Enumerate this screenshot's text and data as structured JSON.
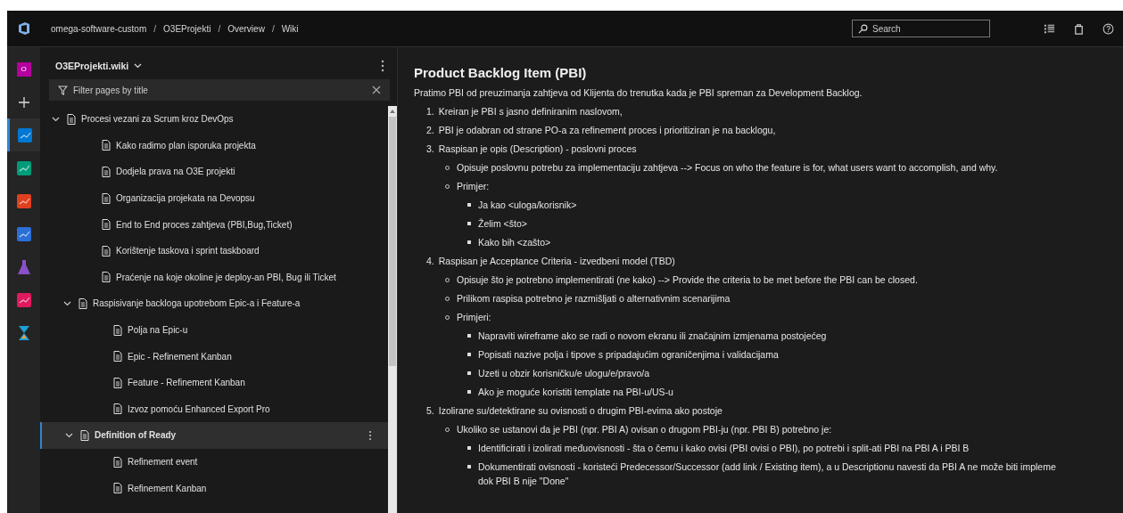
{
  "topbar": {
    "breadcrumb": [
      "omega-software-custom",
      "O3EProjekti",
      "Overview",
      "Wiki"
    ],
    "breadcrumb_separator": "/",
    "search": {
      "placeholder": "Search"
    }
  },
  "rail": [
    {
      "kind": "org",
      "label": "O",
      "selected": false
    },
    {
      "kind": "plus",
      "selected": false
    },
    {
      "kind": "overview",
      "selected": true
    },
    {
      "kind": "boards",
      "selected": false
    },
    {
      "kind": "repos",
      "selected": false
    },
    {
      "kind": "pipelines",
      "selected": false
    },
    {
      "kind": "testplans",
      "selected": false
    },
    {
      "kind": "artifacts",
      "selected": false
    },
    {
      "kind": "hourglass",
      "selected": false
    }
  ],
  "sidebar": {
    "wiki_name": "O3EProjekti.wiki",
    "filter": {
      "placeholder": "Filter pages by title"
    },
    "tree": [
      {
        "label": "Procesi vezani za Scrum kroz DevOps",
        "expanded": true,
        "selected": false,
        "children": [
          {
            "label": "Kako radimo plan isporuka projekta",
            "selected": false
          },
          {
            "label": "Dodjela prava na O3E projekti",
            "selected": false
          },
          {
            "label": "Organizacija projekata na Devopsu",
            "selected": false
          },
          {
            "label": "End to End proces zahtjeva (PBI,Bug,Ticket)",
            "selected": false
          },
          {
            "label": "Korištenje taskova i sprint taskboard",
            "selected": false
          },
          {
            "label": "Praćenje na koje okoline je deploy-an PBI, Bug ili Ticket",
            "selected": false
          },
          {
            "label": "Raspisivanje backloga upotrebom Epic-a i Feature-a",
            "expanded": true,
            "selected": false,
            "children": [
              {
                "label": "Polja na Epic-u",
                "selected": false
              },
              {
                "label": "Epic - Refinement Kanban",
                "selected": false
              },
              {
                "label": "Feature - Refinement Kanban",
                "selected": false
              },
              {
                "label": "Izvoz pomoću Enhanced Export Pro",
                "selected": false
              }
            ]
          },
          {
            "label": "Definition of Ready",
            "expanded": true,
            "selected": true,
            "children": [
              {
                "label": "Refinement event",
                "selected": false
              },
              {
                "label": "Refinement Kanban",
                "selected": false
              }
            ]
          }
        ]
      }
    ]
  },
  "page": {
    "title": "Product Backlog Item (PBI)",
    "intro": "Pratimo PBI od preuzimanja zahtjeva od Klijenta do trenutka kada je PBI spreman za Development Backlog.",
    "items": [
      {
        "number": "1.",
        "lines": [
          "Kreiran je PBI s jasno definiranim naslovom,"
        ]
      },
      {
        "number": "2.",
        "lines": [
          "PBI je odabran od strane PO-a za refinement proces i prioritiziran je na backlogu,"
        ]
      },
      {
        "number": "3.",
        "lines": [
          "Raspisan je opis (Description) - poslovni proces"
        ],
        "children": [
          {
            "lines": [
              "Opisuje poslovnu potrebu za implementaciju zahtjeva --> Focus on who the feature is for, what users want to accomplish, and why."
            ]
          },
          {
            "lines": [
              "Primjer:"
            ],
            "children": [
              {
                "lines": [
                  "Ja kao <uloga/korisnik>"
                ]
              },
              {
                "lines": [
                  "Želim <što>"
                ]
              },
              {
                "lines": [
                  "Kako bih <zašto>"
                ]
              }
            ]
          }
        ]
      },
      {
        "number": "4.",
        "lines": [
          "Raspisan je Acceptance Criteria - izvedbeni model (TBD)"
        ],
        "children": [
          {
            "lines": [
              "Opisuje što je potrebno implementirati (ne kako) --> Provide the criteria to be met before the PBI can be closed."
            ]
          },
          {
            "lines": [
              "Prilikom raspisa potrebno je razmišljati o alternativnim scenarijima"
            ]
          },
          {
            "lines": [
              "Primjeri:"
            ],
            "children": [
              {
                "lines": [
                  "Napraviti wireframe ako se radi o novom ekranu ili značajnim izmjenama postojećeg"
                ]
              },
              {
                "lines": [
                  "Popisati nazive polja i tipove s pripadajućim ograničenjima i validacijama"
                ]
              },
              {
                "lines": [
                  "Uzeti u obzir korisničku/e ulogu/e/pravo/a"
                ]
              },
              {
                "lines": [
                  "Ako je moguće koristiti template na PBI-u/US-u"
                ]
              }
            ]
          }
        ]
      },
      {
        "number": "5.",
        "lines": [
          "Izolirane su/detektirane su ovisnosti o drugim PBI-evima ako postoje"
        ],
        "children": [
          {
            "lines": [
              "Ukoliko se ustanovi da je PBI (npr. PBI A) ovisan o drugom PBI-ju (npr. PBI B) potrebno je:"
            ],
            "children": [
              {
                "lines": [
                  "Identificirati i izolirati međuovisnosti - šta o čemu i kako ovisi (PBI ovisi o PBI), po potrebi i split-ati PBI na PBI A i PBI B"
                ]
              },
              {
                "lines": [
                  "Dokumentirati ovisnosti - koristeći Predecessor/Successor (add link / Existing item), a u Descriptionu navesti da PBI A ne može biti impleme",
                  "dok PBI B nije \"Done\""
                ]
              }
            ]
          }
        ]
      }
    ]
  }
}
